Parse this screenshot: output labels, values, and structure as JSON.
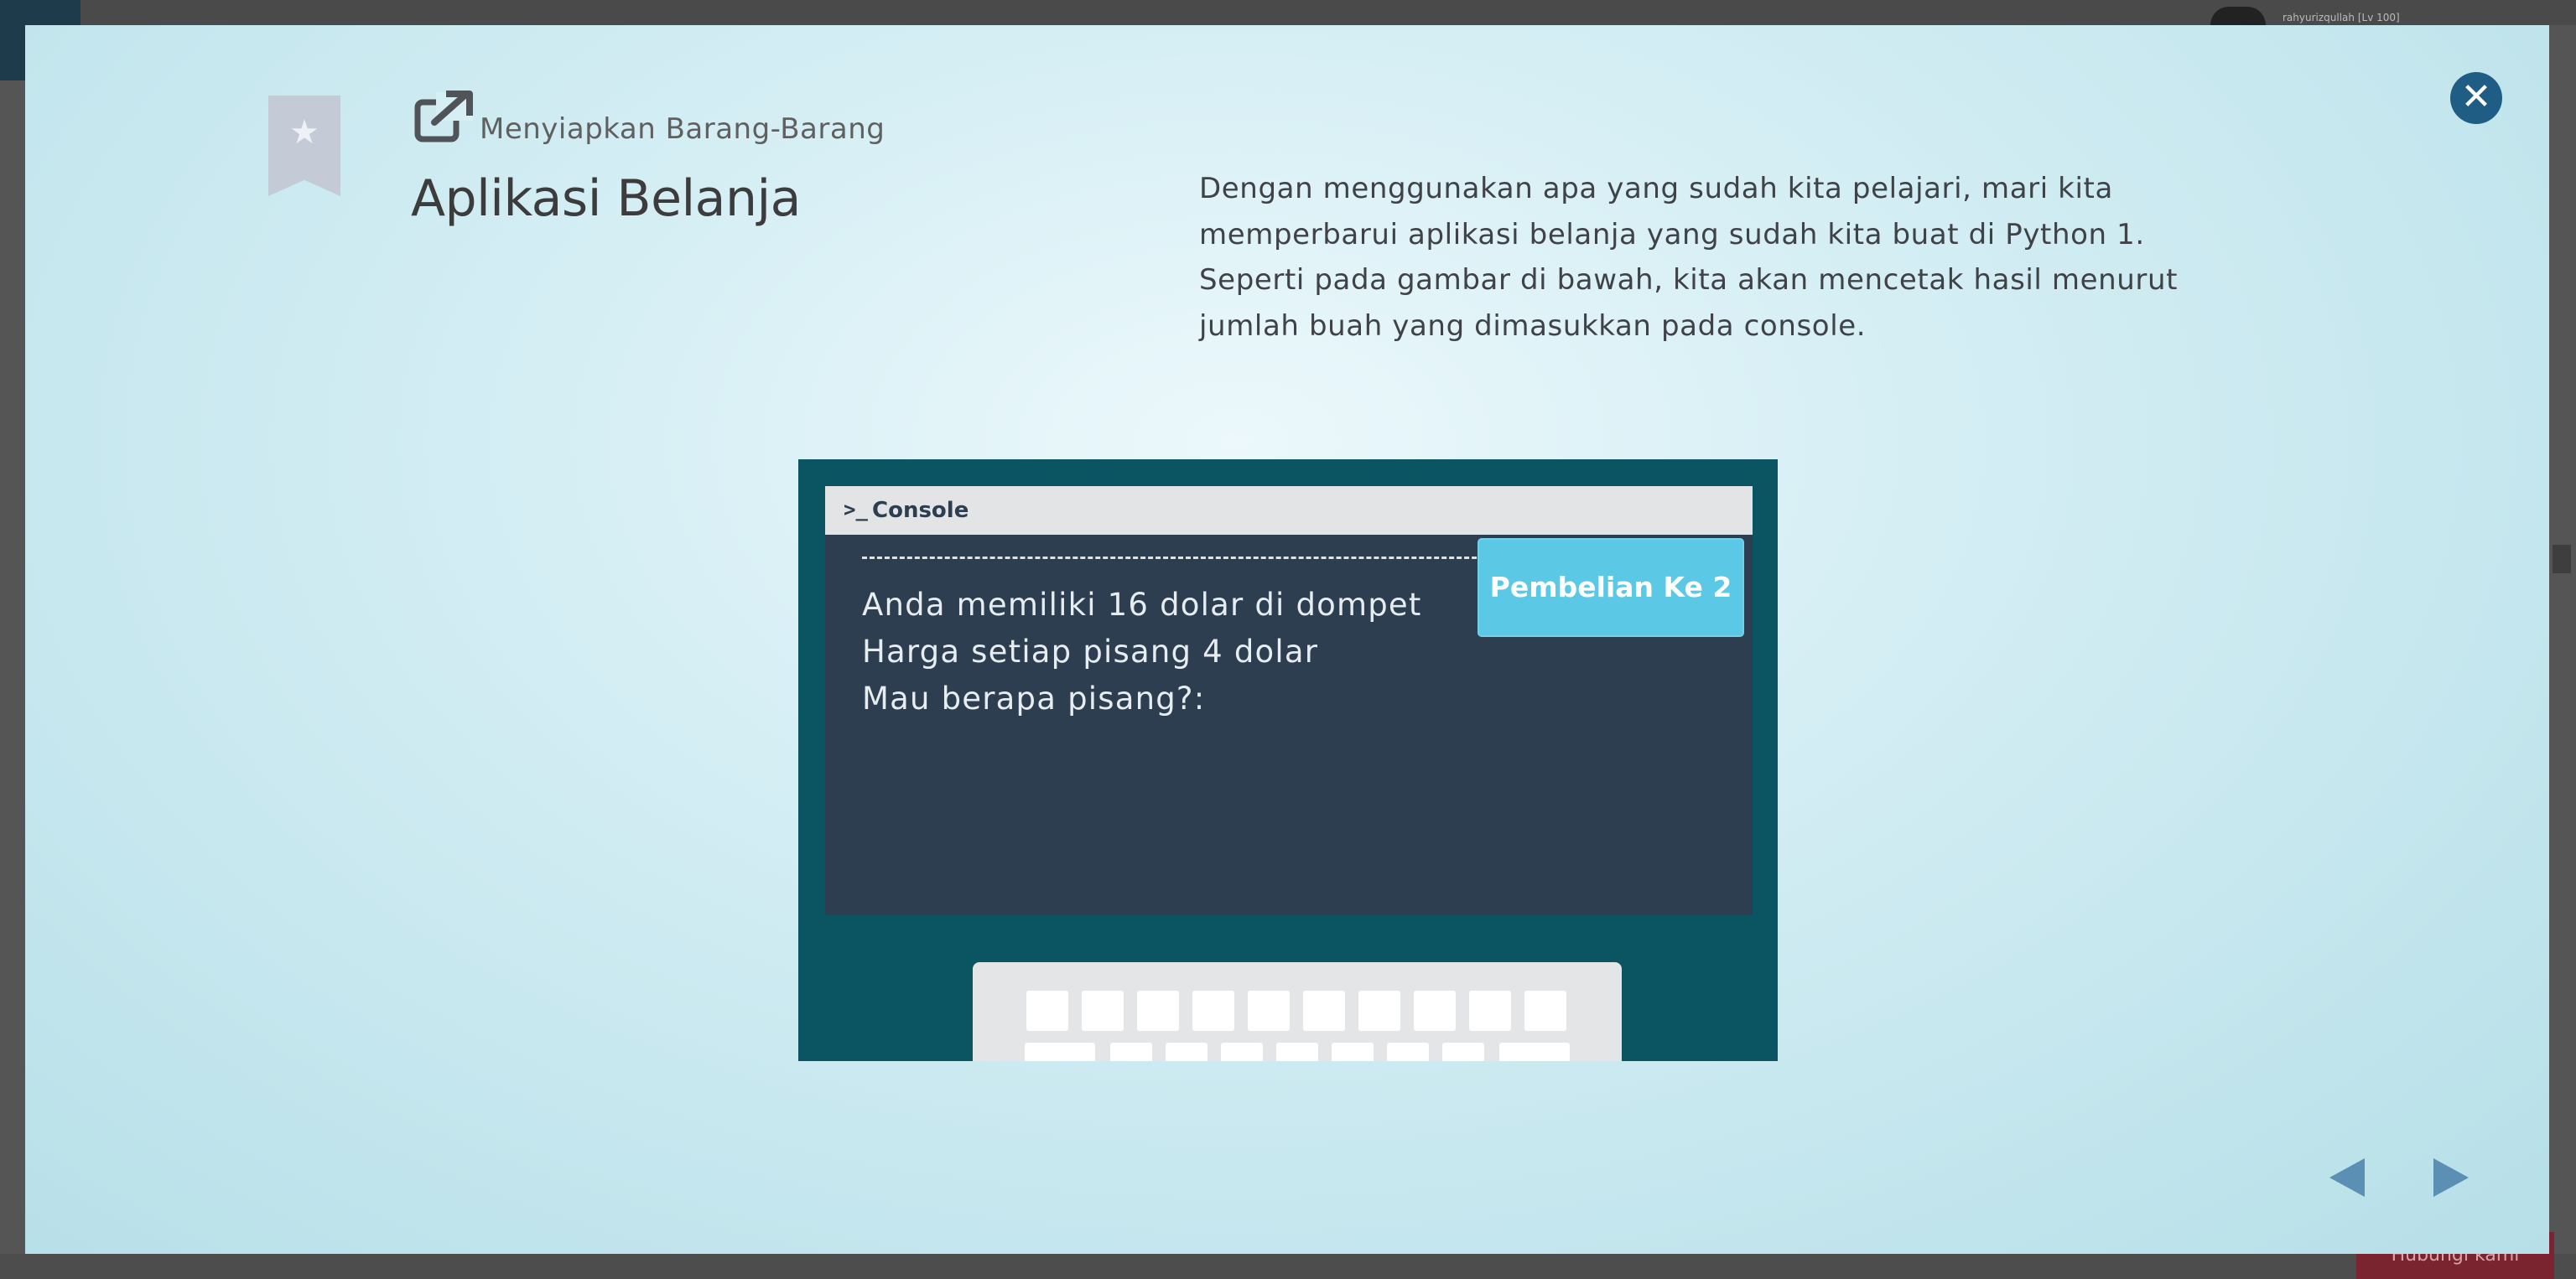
{
  "background": {
    "username": "rahyurizqullah [Lv 100]",
    "bottom_button": "Hubungi kami"
  },
  "header": {
    "subtitle": "Menyiapkan Barang-Barang",
    "title": "Aplikasi Belanja"
  },
  "description": "Dengan menggunakan apa yang sudah kita pelajari, mari kita memperbarui aplikasi belanja yang sudah kita buat di Python 1. Seperti pada gambar di bawah, kita akan mencetak hasil menurut jumlah buah yang dimasukkan pada console.",
  "illustration": {
    "console_icon": ">_",
    "console_label": "Console",
    "badge": "Pembelian Ke 2",
    "lines": [
      "Anda memiliki 16 dolar di dompet",
      "Harga setiap pisang 4 dolar",
      "Mau berapa pisang?:"
    ]
  },
  "icons": {
    "close": "close-icon",
    "bookmark": "bookmark-star-icon",
    "external": "external-link-icon",
    "prev": "arrow-left-icon",
    "next": "arrow-right-icon"
  },
  "colors": {
    "close_button": "#205d85",
    "nav_arrow": "#5b8fb3",
    "illustration_bg": "#0b5563",
    "console_bg": "#2c3e50",
    "badge_bg": "#5bc8e6"
  }
}
